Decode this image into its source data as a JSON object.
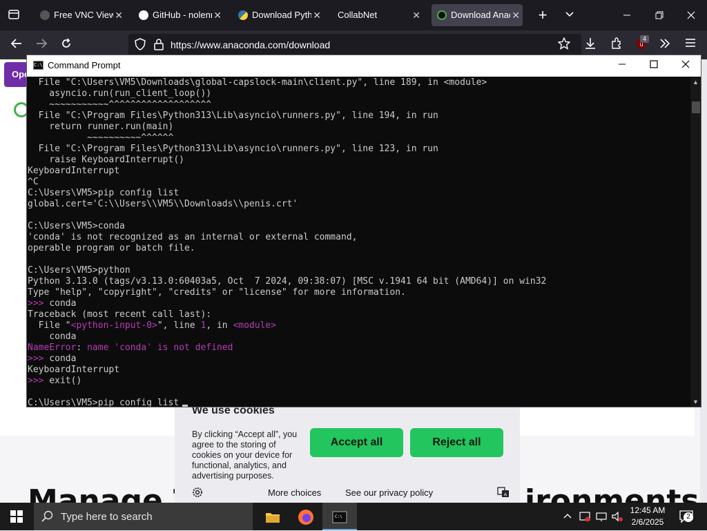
{
  "browser": {
    "tabs": [
      {
        "title": "Free VNC Viewer",
        "close": "✕"
      },
      {
        "title": "GitHub - nolenr",
        "close": "✕"
      },
      {
        "title": "Download Pytho",
        "close": "✕"
      },
      {
        "title": "CollabNet",
        "close": "✕"
      },
      {
        "title": "Download Anac",
        "close": "✕"
      }
    ],
    "url": "https://www.anaconda.com/download",
    "badge_count": "4"
  },
  "webpage": {
    "sidebar_label": "Ope",
    "headline_left": "Manage Tr",
    "headline_right": "ironments",
    "cookie": {
      "title": "We use cookies",
      "text": "By clicking “Accept all”, you agree to the storing of cookies on your device for functional, analytics, and advertising purposes.",
      "accept_label": "Accept all",
      "reject_label": "Reject all",
      "more_choices": "More choices",
      "privacy_link": "See our privacy policy"
    }
  },
  "cmd": {
    "title": "Command Prompt",
    "lines": [
      {
        "text": "  File \"C:\\Users\\VM5\\Downloads\\global-capslock-main\\client.py\", line 189, in <module>"
      },
      {
        "text": "    asyncio.run(run_client_loop())"
      },
      {
        "text": "    ~~~~~~~~~~~^^^^^^^^^^^^^^^^^^^"
      },
      {
        "text": "  File \"C:\\Program Files\\Python313\\Lib\\asyncio\\runners.py\", line 194, in run"
      },
      {
        "text": "    return runner.run(main)"
      },
      {
        "text": "           ~~~~~~~~~~^^^^^^"
      },
      {
        "text": "  File \"C:\\Program Files\\Python313\\Lib\\asyncio\\runners.py\", line 123, in run"
      },
      {
        "text": "    raise KeyboardInterrupt()"
      },
      {
        "text": "KeyboardInterrupt"
      },
      {
        "text": "^C"
      },
      {
        "text": "C:\\Users\\VM5>pip config list"
      },
      {
        "text": "global.cert='C:\\\\Users\\\\VM5\\\\Downloads\\\\penis.crt'"
      },
      {
        "text": ""
      },
      {
        "text": "C:\\Users\\VM5>conda"
      },
      {
        "text": "'conda' is not recognized as an internal or external command,"
      },
      {
        "text": "operable program or batch file."
      },
      {
        "text": ""
      },
      {
        "text": "C:\\Users\\VM5>python"
      },
      {
        "text": "Python 3.13.0 (tags/v3.13.0:60403a5, Oct  7 2024, 09:38:07) [MSC v.1941 64 bit (AMD64)] on win32"
      },
      {
        "text": "Type \"help\", \"copyright\", \"credits\" or \"license\" for more information."
      },
      {
        "text": ">>> conda",
        "prompt": true
      },
      {
        "text": "Traceback (most recent call last):"
      },
      {
        "text": "  File \"<python-input-0>\", line 1, in <module>",
        "colored": true
      },
      {
        "text": "    conda"
      },
      {
        "text": "NameError: name 'conda' is not defined",
        "error": true
      },
      {
        "text": ">>> conda",
        "prompt": true
      },
      {
        "text": "KeyboardInterrupt"
      },
      {
        "text": ">>> exit()",
        "prompt": true
      },
      {
        "text": ""
      },
      {
        "text": "C:\\Users\\VM5>pip config list"
      }
    ]
  },
  "taskbar": {
    "search_placeholder": "Type here to search",
    "time": "12:45 AM",
    "date": "2/6/2025",
    "notification_count": "2"
  }
}
